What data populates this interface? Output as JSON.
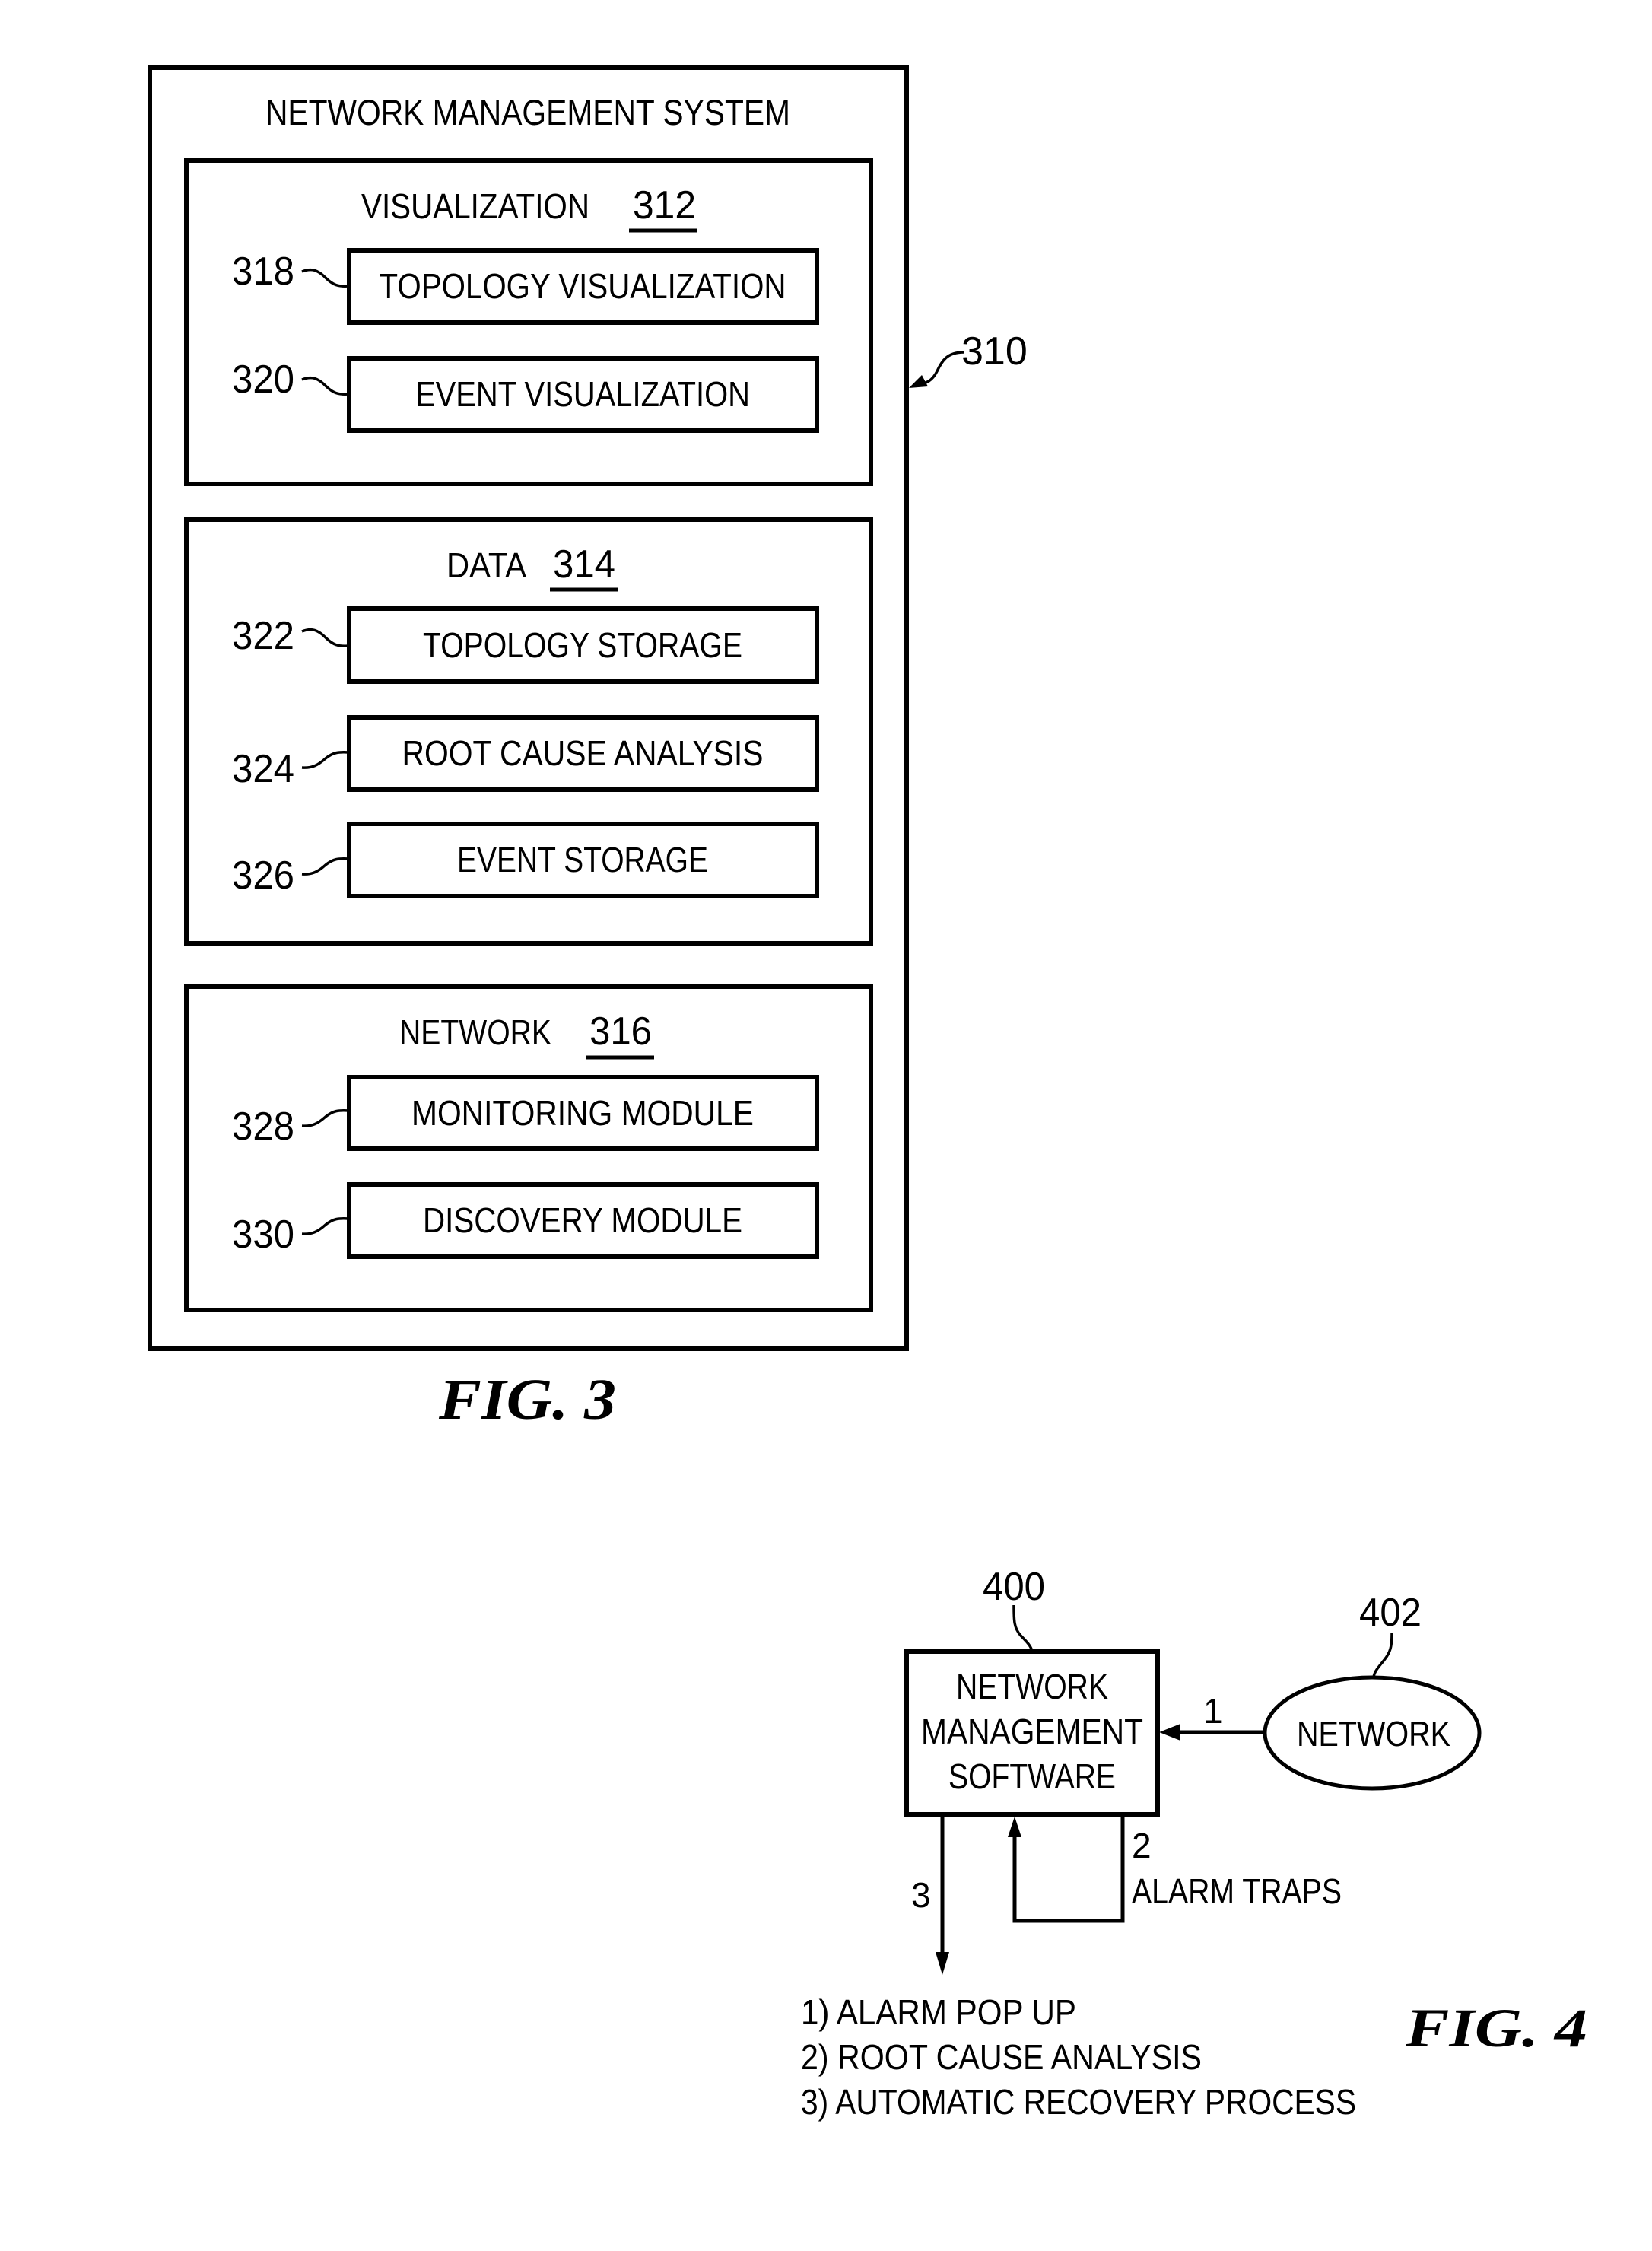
{
  "fig3": {
    "caption": "FIG. 3",
    "system": {
      "title": "NETWORK MANAGEMENT SYSTEM",
      "ref": "310"
    },
    "sections": [
      {
        "title": "VISUALIZATION",
        "ref": "312",
        "modules": [
          {
            "label": "TOPOLOGY VISUALIZATION",
            "ref": "318"
          },
          {
            "label": "EVENT VISUALIZATION",
            "ref": "320"
          }
        ]
      },
      {
        "title": "DATA",
        "ref": "314",
        "modules": [
          {
            "label": "TOPOLOGY STORAGE",
            "ref": "322"
          },
          {
            "label": "ROOT CAUSE ANALYSIS",
            "ref": "324"
          },
          {
            "label": "EVENT STORAGE",
            "ref": "326"
          }
        ]
      },
      {
        "title": "NETWORK",
        "ref": "316",
        "modules": [
          {
            "label": "MONITORING MODULE",
            "ref": "328"
          },
          {
            "label": "DISCOVERY MODULE",
            "ref": "330"
          }
        ]
      }
    ]
  },
  "fig4": {
    "caption": "FIG. 4",
    "software": {
      "lines": [
        "NETWORK",
        "MANAGEMENT",
        "SOFTWARE"
      ],
      "ref": "400"
    },
    "network": {
      "label": "NETWORK",
      "ref": "402"
    },
    "flows": {
      "step1": "1",
      "step2": "2",
      "step2_label": "ALARM TRAPS",
      "step3": "3"
    },
    "outcomes": [
      "1) ALARM POP UP",
      "2) ROOT CAUSE ANALYSIS",
      "3) AUTOMATIC RECOVERY PROCESS"
    ]
  }
}
